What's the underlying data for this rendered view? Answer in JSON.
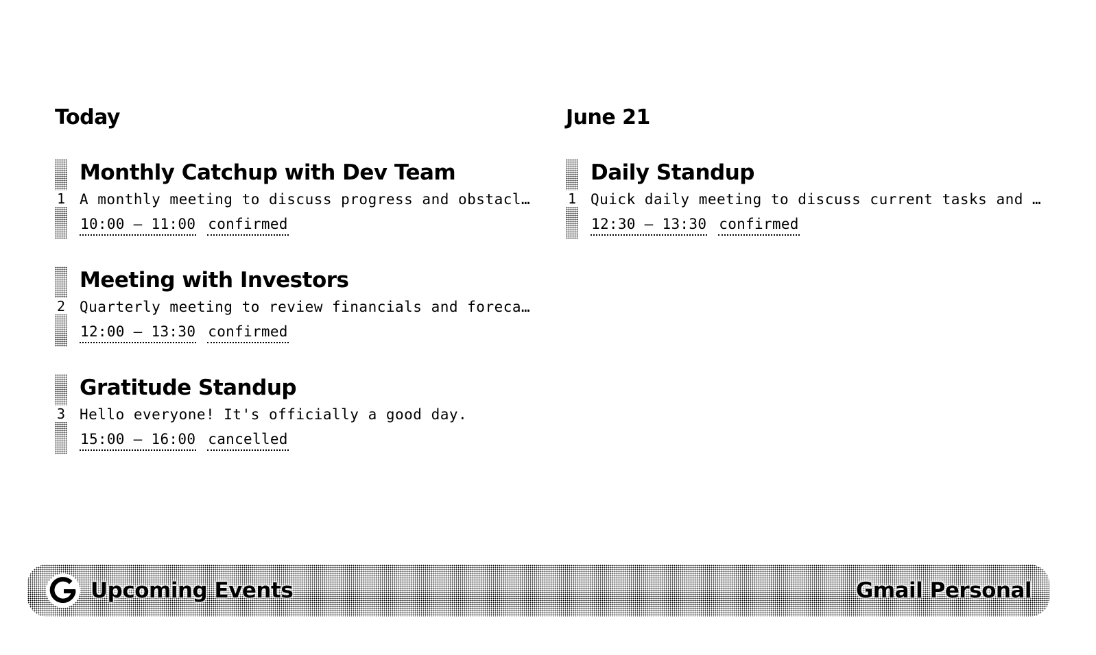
{
  "days": [
    {
      "heading": "Today",
      "events": [
        {
          "index": "1",
          "title": "Monthly Catchup with Dev Team",
          "description": "A monthly meeting to discuss progress and obstacle…",
          "time": "10:00 – 11:00",
          "status": "confirmed"
        },
        {
          "index": "2",
          "title": "Meeting with Investors",
          "description": "Quarterly meeting to review financials and forecas…",
          "time": "12:00 – 13:30",
          "status": "confirmed"
        },
        {
          "index": "3",
          "title": "Gratitude Standup",
          "description": "Hello everyone! It's officially a good day.",
          "time": "15:00 – 16:00",
          "status": "cancelled"
        }
      ]
    },
    {
      "heading": "June 21",
      "events": [
        {
          "index": "1",
          "title": "Daily Standup",
          "description": "Quick daily meeting to discuss current tasks and im…",
          "time": "12:30 – 13:30",
          "status": "confirmed"
        }
      ]
    }
  ],
  "footer": {
    "icon": "google-g-icon",
    "title": "Upcoming Events",
    "account": "Gmail Personal"
  },
  "colors": {
    "foreground": "#000000",
    "background": "#ffffff"
  }
}
